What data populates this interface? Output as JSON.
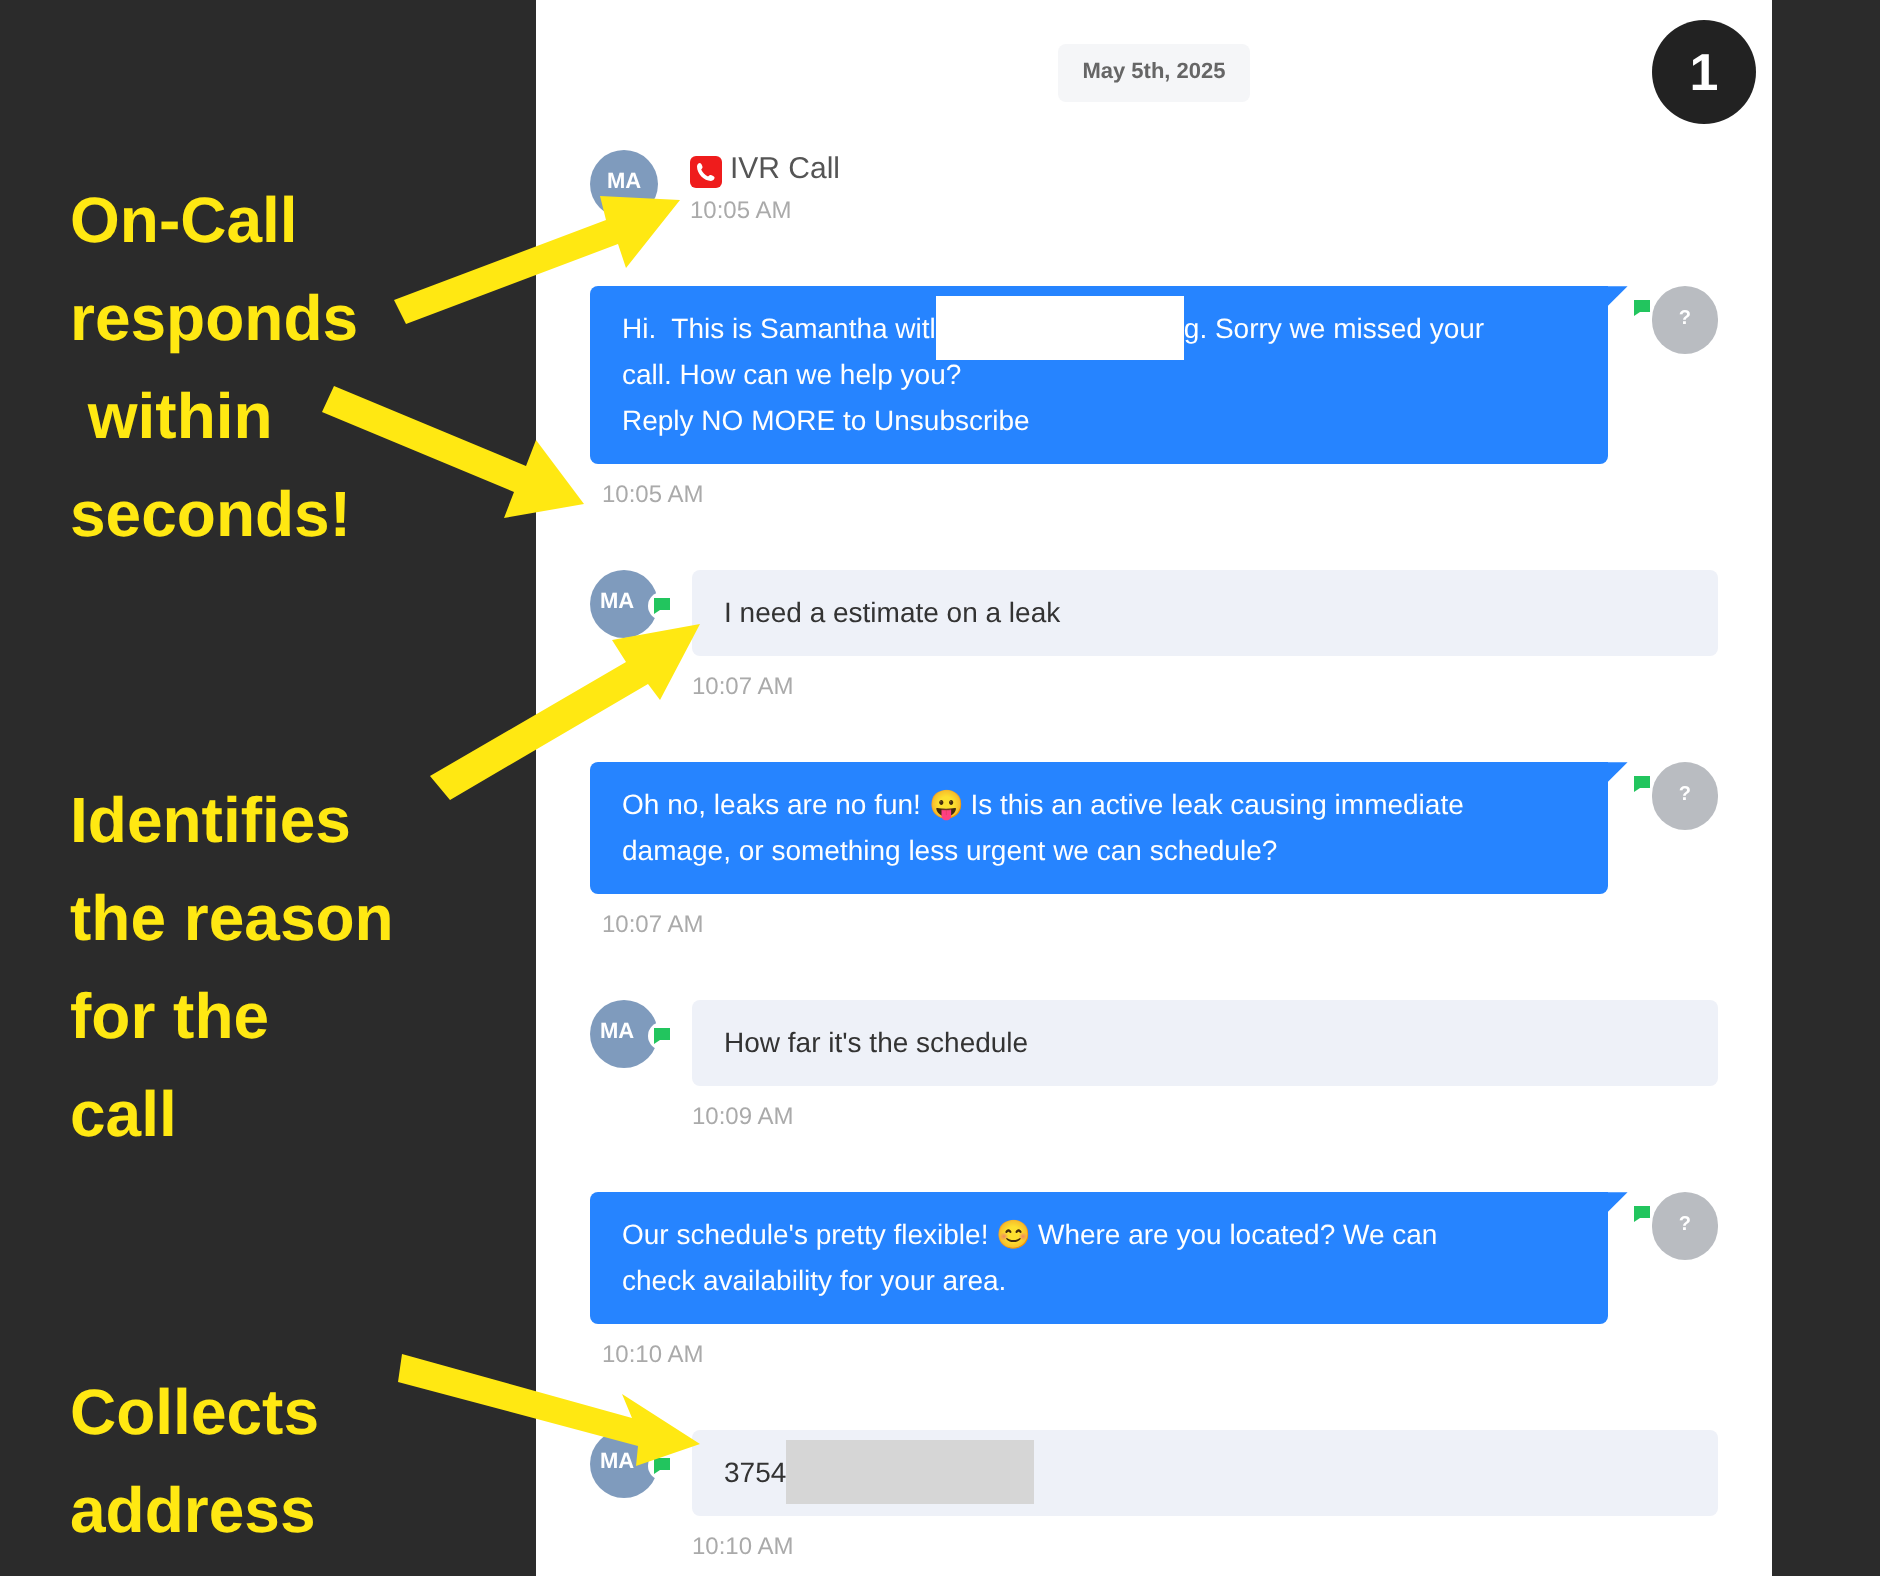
{
  "badge": "1",
  "annotations": [
    {
      "text": "On-Call\nresponds\n within\nseconds!"
    },
    {
      "text": "Identifies\nthe reason\nfor the\ncall"
    },
    {
      "text": "Collects\naddress"
    }
  ],
  "date_chip": "May 5th, 2025",
  "messages": [
    {
      "kind": "call",
      "avatar": "MA",
      "title": "IVR Call",
      "time": "10:05 AM"
    },
    {
      "kind": "outgoing",
      "avatar": "?",
      "lines": [
        [
          {
            "kind": "text",
            "text": "Hi.  This is Samantha witl"
          },
          {
            "kind": "redaction"
          },
          {
            "kind": "text",
            "text": "g. Sorry we missed your"
          }
        ],
        [
          {
            "kind": "text",
            "text": "call. How can we help you?"
          }
        ],
        [
          {
            "kind": "text",
            "text": "Reply NO MORE to Unsubscribe"
          }
        ]
      ],
      "time": "10:05 AM"
    },
    {
      "kind": "incoming",
      "avatar": "MA",
      "lines": [
        [
          {
            "kind": "text",
            "text": "I need a estimate on a leak"
          }
        ]
      ],
      "time": "10:07 AM"
    },
    {
      "kind": "outgoing",
      "avatar": "?",
      "lines": [
        [
          {
            "kind": "text",
            "text": "Oh no, leaks are no fun! 😛 Is this an active leak causing immediate"
          }
        ],
        [
          {
            "kind": "text",
            "text": "damage, or something less urgent we can schedule?"
          }
        ]
      ],
      "time": "10:07 AM"
    },
    {
      "kind": "incoming",
      "avatar": "MA",
      "lines": [
        [
          {
            "kind": "text",
            "text": "How far it's the schedule"
          }
        ]
      ],
      "time": "10:09 AM"
    },
    {
      "kind": "outgoing",
      "avatar": "?",
      "lines": [
        [
          {
            "kind": "text",
            "text": "Our schedule's pretty flexible! 😊 Where are you located? We can"
          }
        ],
        [
          {
            "kind": "text",
            "text": "check availability for your area."
          }
        ]
      ],
      "time": "10:10 AM"
    },
    {
      "kind": "incoming",
      "avatar": "MA",
      "lines": [
        [
          {
            "kind": "text",
            "text": "3754"
          },
          {
            "kind": "redaction"
          }
        ]
      ],
      "time": "10:10 AM"
    }
  ]
}
